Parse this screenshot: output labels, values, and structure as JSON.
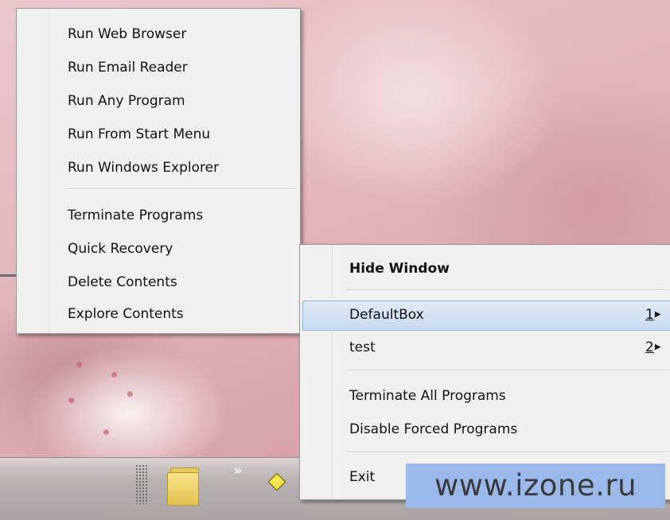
{
  "context_menu": {
    "items": [
      {
        "label": "Run Web Browser"
      },
      {
        "label": "Run Email Reader"
      },
      {
        "label": "Run Any Program"
      },
      {
        "label": "Run From Start Menu"
      },
      {
        "label": "Run Windows Explorer"
      },
      {
        "label": "Terminate Programs"
      },
      {
        "label": "Quick Recovery"
      },
      {
        "label": "Delete Contents"
      },
      {
        "label": "Explore Contents"
      }
    ]
  },
  "tray_menu": {
    "hide_window": "Hide Window",
    "boxes": [
      {
        "label": "DefaultBox",
        "shortcut": "1",
        "highlighted": true
      },
      {
        "label": "test",
        "shortcut": "2",
        "highlighted": false
      }
    ],
    "terminate_all": "Terminate All Programs",
    "disable_forced": "Disable Forced Programs",
    "exit": "Exit"
  },
  "taskbar": {
    "overflow_chevron": "»"
  },
  "watermark": "www.izone.ru",
  "colors": {
    "highlight": "#c7dbf1",
    "watermark_bg": "#9ab9ea"
  }
}
